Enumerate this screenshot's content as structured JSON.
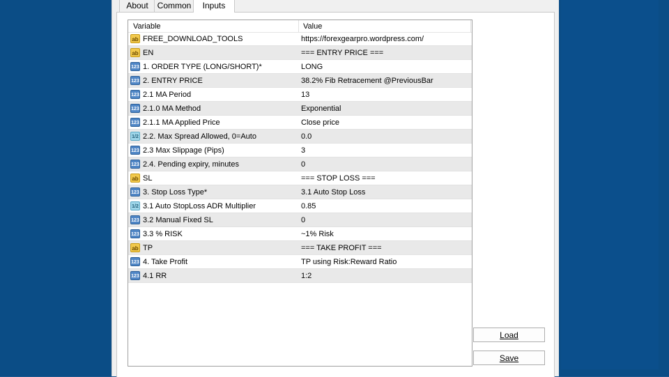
{
  "tabs": [
    {
      "label": "About"
    },
    {
      "label": "Common"
    },
    {
      "label": "Inputs"
    }
  ],
  "table": {
    "columns": [
      "Variable",
      "Value"
    ],
    "rows": [
      {
        "icon": "ab",
        "variable": "FREE_DOWNLOAD_TOOLS",
        "value": "https://forexgearpro.wordpress.com/"
      },
      {
        "icon": "ab",
        "variable": "EN",
        "value": "=== ENTRY PRICE ==="
      },
      {
        "icon": "123",
        "variable": "1. ORDER TYPE (LONG/SHORT)*",
        "value": "LONG"
      },
      {
        "icon": "123",
        "variable": "2. ENTRY PRICE",
        "value": "38.2% Fib Retracement @PreviousBar"
      },
      {
        "icon": "123",
        "variable": "2.1 MA Period",
        "value": "13"
      },
      {
        "icon": "123",
        "variable": "2.1.0 MA Method",
        "value": "Exponential"
      },
      {
        "icon": "123",
        "variable": "2.1.1 MA Applied Price",
        "value": "Close price"
      },
      {
        "icon": "1/2",
        "variable": "2.2. Max Spread Allowed, 0=Auto",
        "value": "0.0"
      },
      {
        "icon": "123",
        "variable": "2.3 Max Slippage (Pips)",
        "value": "3"
      },
      {
        "icon": "123",
        "variable": "2.4. Pending expiry, minutes",
        "value": "0"
      },
      {
        "icon": "ab",
        "variable": "SL",
        "value": "=== STOP LOSS ==="
      },
      {
        "icon": "123",
        "variable": "3. Stop Loss Type*",
        "value": "3.1 Auto Stop Loss"
      },
      {
        "icon": "1/2",
        "variable": "3.1 Auto StopLoss ADR Multiplier",
        "value": "0.85"
      },
      {
        "icon": "123",
        "variable": "3.2 Manual Fixed SL",
        "value": "0"
      },
      {
        "icon": "123",
        "variable": "3.3 % RISK",
        "value": "~1% Risk"
      },
      {
        "icon": "ab",
        "variable": "TP",
        "value": "=== TAKE PROFIT ==="
      },
      {
        "icon": "123",
        "variable": "4. Take Profit",
        "value": "TP using Risk:Reward Ratio"
      },
      {
        "icon": "123",
        "variable": "4.1 RR",
        "value": "1:2"
      }
    ]
  },
  "buttons": {
    "load_label": "Load",
    "save_label": "Save"
  }
}
